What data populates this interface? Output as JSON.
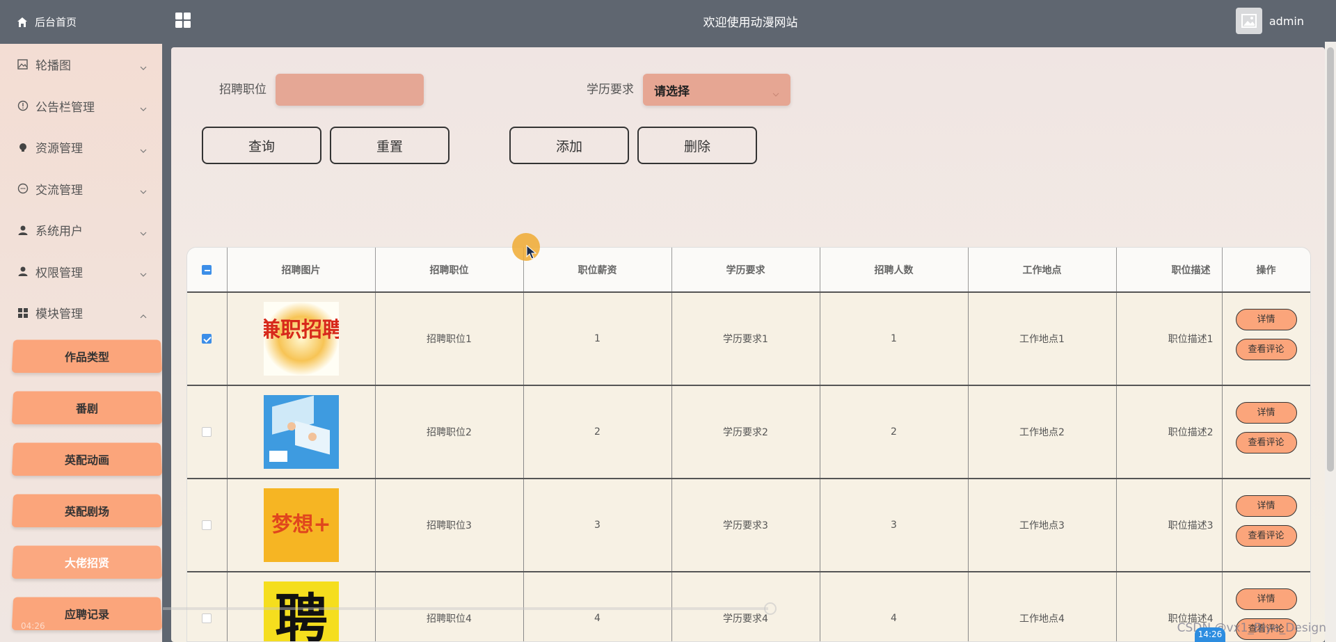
{
  "sidebar": {
    "home": "后台首页",
    "menu": [
      {
        "label": "轮播图",
        "icon": "picture-icon"
      },
      {
        "label": "公告栏管理",
        "icon": "info-circle-icon"
      },
      {
        "label": "资源管理",
        "icon": "bulb-icon"
      },
      {
        "label": "交流管理",
        "icon": "chat-icon"
      },
      {
        "label": "系统用户",
        "icon": "user-icon"
      },
      {
        "label": "权限管理",
        "icon": "user-icon"
      },
      {
        "label": "模块管理",
        "icon": "grid-icon"
      }
    ],
    "submenu": [
      "作品类型",
      "番剧",
      "英配动画",
      "英配剧场",
      "大佬招贤",
      "应聘记录"
    ]
  },
  "topbar": {
    "title": "欢迎使用动漫网站",
    "user": "admin"
  },
  "filters": {
    "position_label": "招聘职位",
    "position_value": "",
    "education_label": "学历要求",
    "education_placeholder": "请选择"
  },
  "buttons": {
    "search": "查询",
    "reset": "重置",
    "add": "添加",
    "delete": "删除"
  },
  "table": {
    "headers": [
      "招聘图片",
      "招聘职位",
      "职位薪资",
      "学历要求",
      "招聘人数",
      "工作地点",
      "职位描述",
      "操作"
    ],
    "rows": [
      {
        "checked": true,
        "position": "招聘职位1",
        "salary": "1",
        "education": "学历要求1",
        "count": "1",
        "location": "工作地点1",
        "description": "职位描述1",
        "image": "兼职招聘"
      },
      {
        "checked": false,
        "position": "招聘职位2",
        "salary": "2",
        "education": "学历要求2",
        "count": "2",
        "location": "工作地点2",
        "description": "职位描述2",
        "image": "office"
      },
      {
        "checked": false,
        "position": "招聘职位3",
        "salary": "3",
        "education": "学历要求3",
        "count": "3",
        "location": "工作地点3",
        "description": "职位描述3",
        "image": "梦想+"
      },
      {
        "checked": false,
        "position": "招聘职位4",
        "salary": "4",
        "education": "学历要求4",
        "count": "4",
        "location": "工作地点4",
        "description": "职位描述4",
        "image": "聘"
      }
    ],
    "detail_label": "详情",
    "comments_label": "查看评论"
  },
  "overlay": {
    "watermark": "CSDN @vx1_Biye_Design",
    "time_badge": "14:26",
    "time_left": "04:26"
  }
}
